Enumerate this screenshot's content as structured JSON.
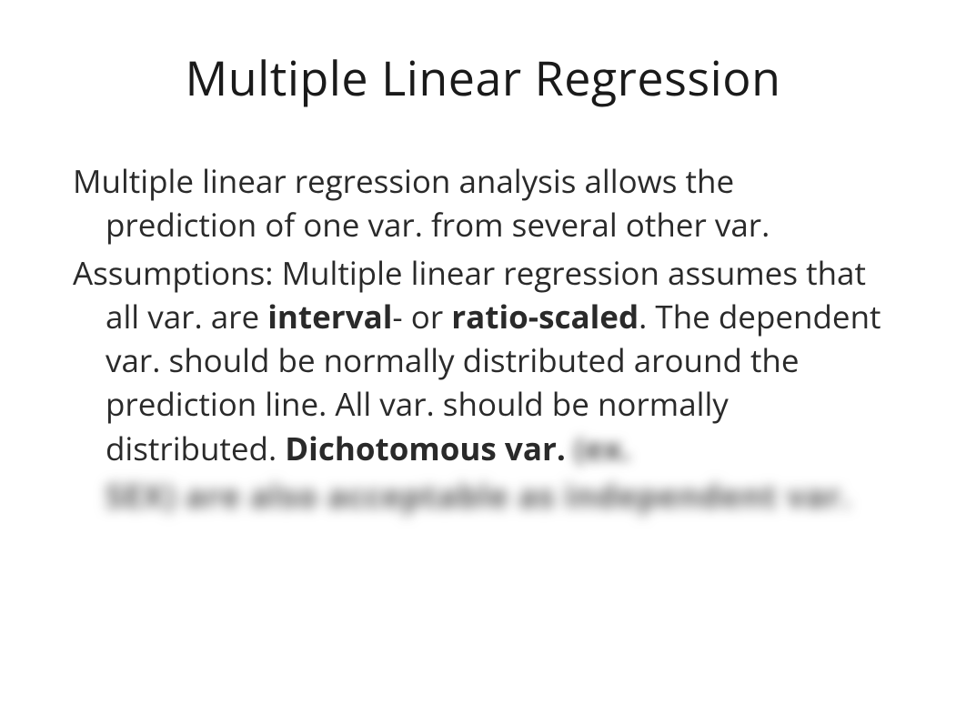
{
  "slide": {
    "title": "Multiple Linear Regression",
    "paragraph1": "Multiple linear regression analysis allows the prediction of one var. from several other var.",
    "paragraph2_part1": "Assumptions: Multiple linear regression assumes that all var. are ",
    "paragraph2_bold1": "interval",
    "paragraph2_part2": "- or ",
    "paragraph2_bold2": "ratio-scaled",
    "paragraph2_part3": ". The dependent var. should be normally distributed around the prediction line. All var. should be normally distributed. ",
    "paragraph2_bold3": "Dichotomous var.",
    "blurred_inline": " (ex.",
    "blurred_line": "SEX) are also acceptable as independent var."
  }
}
